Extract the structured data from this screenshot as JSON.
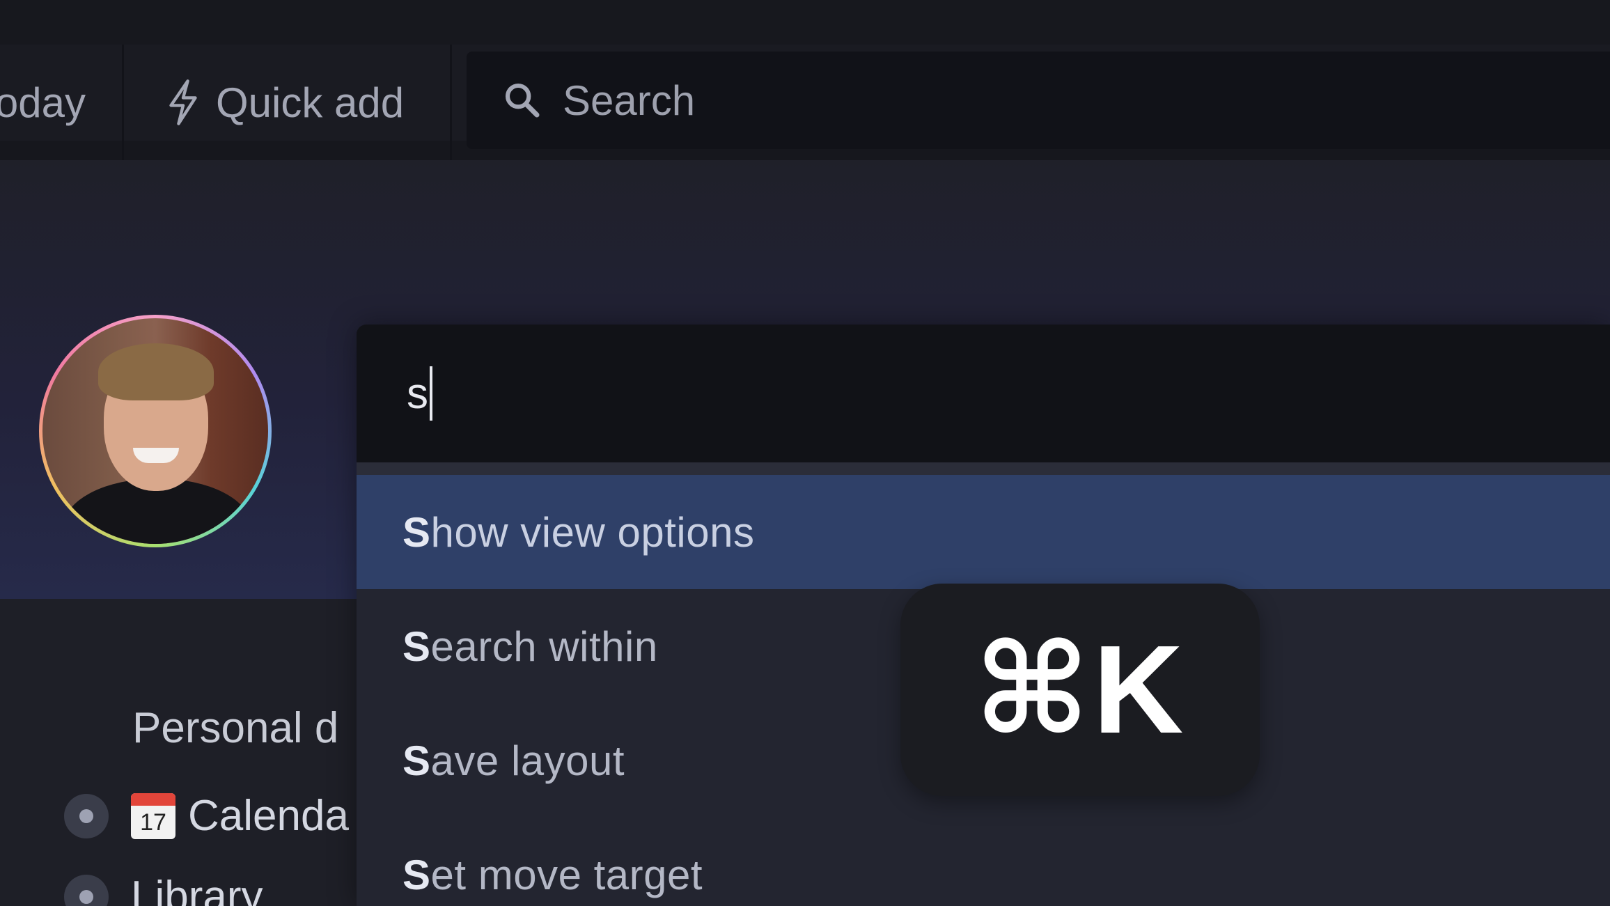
{
  "toolbar": {
    "today_label": "oday",
    "quick_add_label": "Quick add",
    "search_label": "Search"
  },
  "sidebar": {
    "section_label": "Personal d",
    "items": [
      {
        "label": "Calenda",
        "icon": "calendar-icon",
        "icon_text": "17"
      },
      {
        "label": "Library"
      }
    ]
  },
  "palette": {
    "query": "s",
    "commands": [
      {
        "highlight": "S",
        "rest": "how view options",
        "active": true
      },
      {
        "highlight": "S",
        "rest": "earch within"
      },
      {
        "highlight": "S",
        "rest": "ave layout"
      },
      {
        "highlight": "S",
        "rest": "et move target"
      }
    ]
  },
  "shortcut": {
    "keys": "⌘K"
  },
  "colors": {
    "active_row": "#2f4068",
    "palette_bg": "#232530",
    "input_bg": "#111217"
  }
}
